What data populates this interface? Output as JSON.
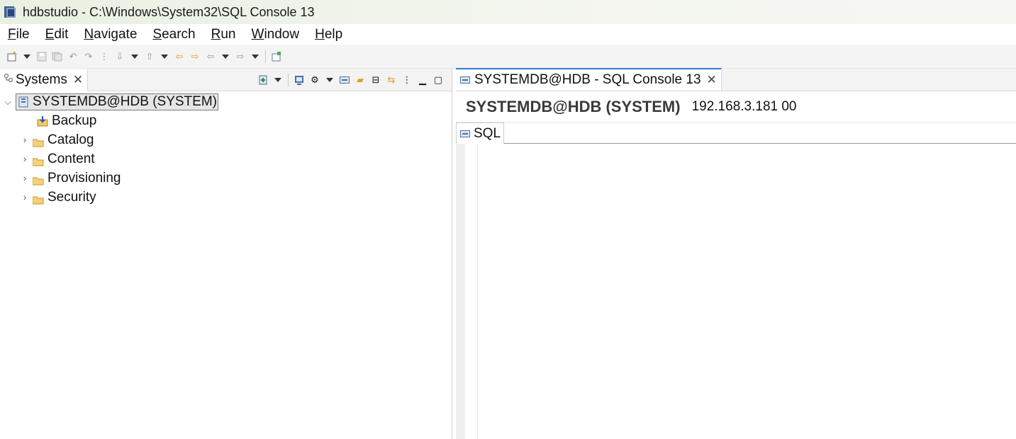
{
  "window": {
    "title": "hdbstudio - C:\\Windows\\System32\\SQL Console 13"
  },
  "menu": [
    "File",
    "Edit",
    "Navigate",
    "Search",
    "Run",
    "Window",
    "Help"
  ],
  "left_panel": {
    "tab_label": "Systems",
    "tree": {
      "root": "SYSTEMDB@HDB (SYSTEM)",
      "children": [
        "Backup",
        "Catalog",
        "Content",
        "Provisioning",
        "Security"
      ]
    }
  },
  "editor": {
    "tab_label": "SYSTEMDB@HDB - SQL Console 13",
    "connection_name": "SYSTEMDB@HDB (SYSTEM)",
    "connection_host": "192.168.3.181 00",
    "sql_tab_label": "SQL"
  },
  "icons": {
    "close": "close-icon",
    "expand": "chevron-right-icon",
    "collapse": "chevron-down-icon",
    "folder": "folder-icon",
    "backup": "backup-icon",
    "system": "database-system-icon"
  },
  "colors": {
    "active_tab_accent": "#2f7bd6",
    "folder": "#e6b34a"
  }
}
